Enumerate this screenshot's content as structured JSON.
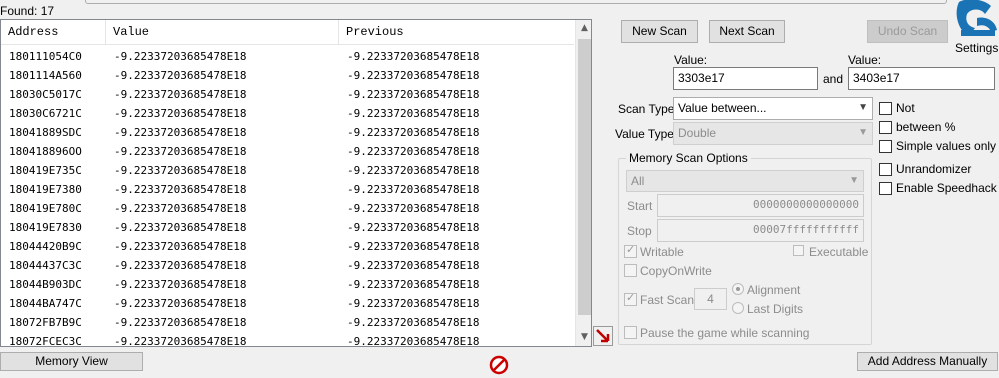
{
  "found_label": "Found: 17",
  "columns": [
    "Address",
    "Value",
    "Previous"
  ],
  "rows": [
    {
      "address": "180111054C0",
      "value": "-9.22337203685478E18",
      "previous": "-9.22337203685478E18"
    },
    {
      "address": "1801114A560",
      "value": "-9.22337203685478E18",
      "previous": "-9.22337203685478E18"
    },
    {
      "address": "18030C5017C",
      "value": "-9.22337203685478E18",
      "previous": "-9.22337203685478E18"
    },
    {
      "address": "18030C6721C",
      "value": "-9.22337203685478E18",
      "previous": "-9.22337203685478E18"
    },
    {
      "address": "18041889SDC",
      "value": "-9.22337203685478E18",
      "previous": "-9.22337203685478E18"
    },
    {
      "address": "180418896OO",
      "value": "-9.22337203685478E18",
      "previous": "-9.22337203685478E18"
    },
    {
      "address": "180419E735C",
      "value": "-9.22337203685478E18",
      "previous": "-9.22337203685478E18"
    },
    {
      "address": "180419E7380",
      "value": "-9.22337203685478E18",
      "previous": "-9.22337203685478E18"
    },
    {
      "address": "180419E780C",
      "value": "-9.22337203685478E18",
      "previous": "-9.22337203685478E18"
    },
    {
      "address": "180419E7830",
      "value": "-9.22337203685478E18",
      "previous": "-9.22337203685478E18"
    },
    {
      "address": "18044420B9C",
      "value": "-9.22337203685478E18",
      "previous": "-9.22337203685478E18"
    },
    {
      "address": "18044437C3C",
      "value": "-9.22337203685478E18",
      "previous": "-9.22337203685478E18"
    },
    {
      "address": "18044B903DC",
      "value": "-9.22337203685478E18",
      "previous": "-9.22337203685478E18"
    },
    {
      "address": "18044BA747C",
      "value": "-9.22337203685478E18",
      "previous": "-9.22337203685478E18"
    },
    {
      "address": "18072FB7B9C",
      "value": "-9.22337203685478E18",
      "previous": "-9.22337203685478E18"
    },
    {
      "address": "18072FCEC3C",
      "value": "-9.22337203685478E18",
      "previous": "-9.22337203685478E18"
    }
  ],
  "buttons": {
    "new_scan": "New Scan",
    "next_scan": "Next Scan",
    "undo_scan": "Undo Scan",
    "memory_view": "Memory View",
    "add_address_manually": "Add Address Manually"
  },
  "settings_label": "Settings",
  "value_label_1": "Value:",
  "value_label_2": "Value:",
  "value_input_1": "3303e17",
  "value_input_2": "3403e17",
  "and_label": "and",
  "scan_type_label": "Scan Type",
  "scan_type_value": "Value between...",
  "value_type_label": "Value Type",
  "value_type_value": "Double",
  "memory_scan_options": {
    "title": "Memory Scan Options",
    "region": "All",
    "start_label": "Start",
    "start_value": "0000000000000000",
    "stop_label": "Stop",
    "stop_value": "00007fffffffffff",
    "writable": "Writable",
    "executable": "Executable",
    "copy_on_write": "CopyOnWrite",
    "fast_scan": "Fast Scan",
    "fast_scan_value": "4",
    "alignment": "Alignment",
    "last_digits": "Last Digits",
    "pause_game": "Pause the game while scanning"
  },
  "options": {
    "not": "Not",
    "between_pct": "between %",
    "simple_values_only": "Simple values only",
    "unrandomizer": "Unrandomizer",
    "enable_speedhack": "Enable Speedhack"
  },
  "colors": {
    "window_bg": "#f0f0f0",
    "list_bg": "#ffffff",
    "cancel_red": "#cc0000",
    "logo_blue": "#1a73b5"
  }
}
